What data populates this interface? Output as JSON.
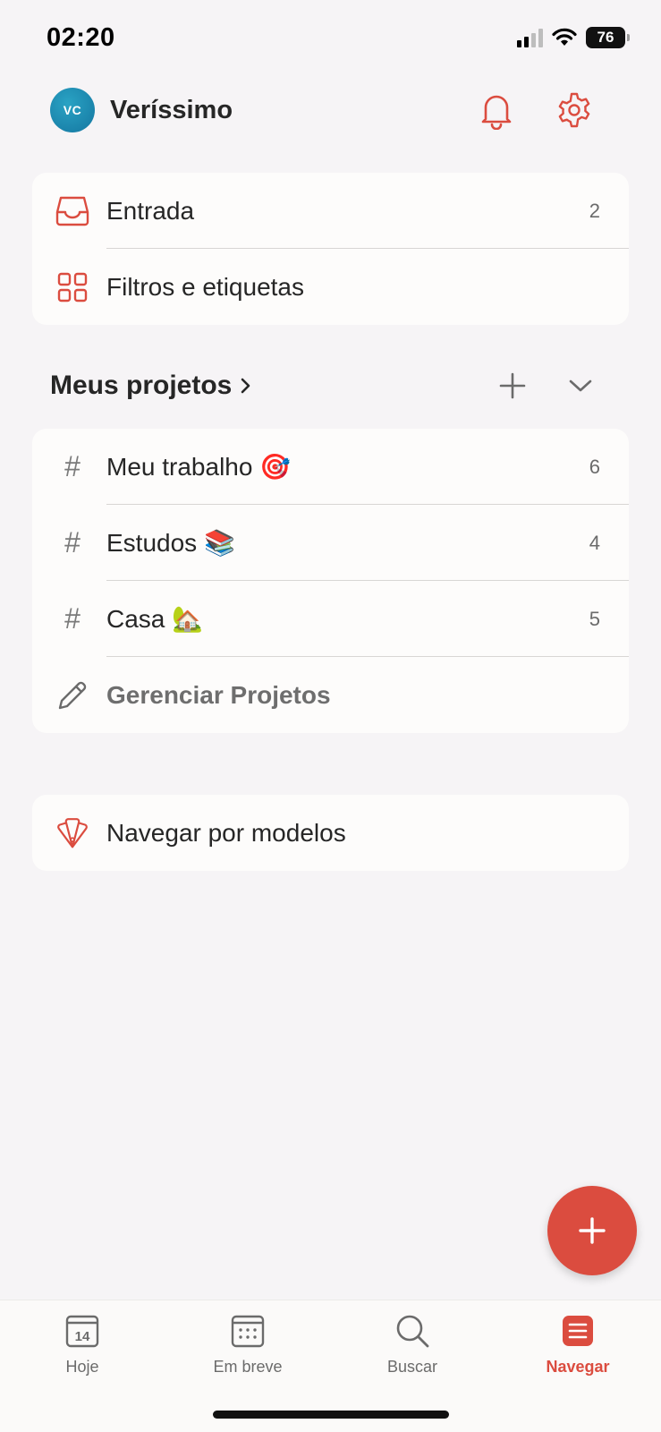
{
  "status_bar": {
    "time": "02:20",
    "battery": "76"
  },
  "header": {
    "avatar_initials": "VC",
    "user_name": "Veríssimo"
  },
  "top_card": {
    "items": [
      {
        "label": "Entrada",
        "count": "2",
        "icon": "inbox-icon"
      },
      {
        "label": "Filtros e etiquetas",
        "count": "",
        "icon": "grid-icon"
      }
    ]
  },
  "projects": {
    "title": "Meus projetos",
    "items": [
      {
        "label": "Meu trabalho 🎯",
        "count": "6"
      },
      {
        "label": "Estudos 📚",
        "count": "4"
      },
      {
        "label": "Casa 🏡",
        "count": "5"
      }
    ],
    "manage_label": "Gerenciar Projetos"
  },
  "templates": {
    "label": "Navegar por modelos"
  },
  "bottom_nav": {
    "items": [
      {
        "label": "Hoje",
        "day": "14"
      },
      {
        "label": "Em breve"
      },
      {
        "label": "Buscar"
      },
      {
        "label": "Navegar"
      }
    ],
    "active": "Navegar"
  },
  "colors": {
    "accent": "#db4c3f",
    "background": "#f6f4f6",
    "card": "#fdfcfb"
  }
}
